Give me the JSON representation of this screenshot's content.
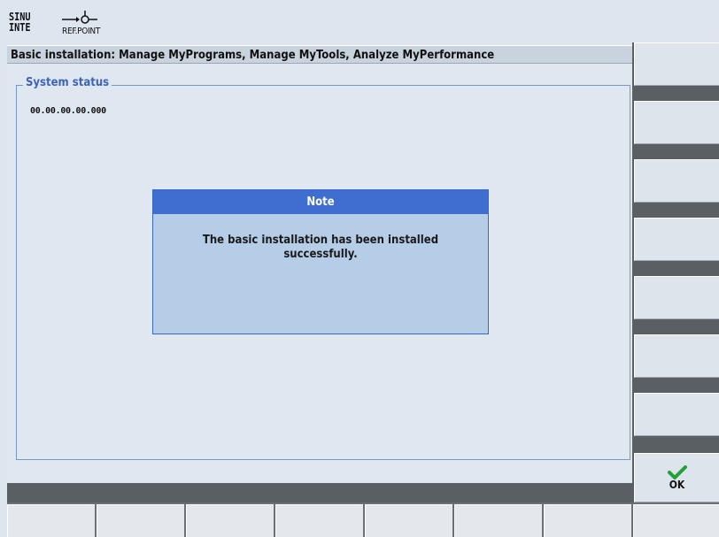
{
  "top": {
    "logo_line1": "SINU",
    "logo_line2": "INTE",
    "refpoint_label": "REF.POINT"
  },
  "header": {
    "title": "Basic installation: Manage MyPrograms, Manage MyTools, Analyze MyPerformance"
  },
  "main": {
    "group_title": "System status",
    "status_value": "00.00.00.00.000"
  },
  "dialog": {
    "title": "Note",
    "message": "The basic installation has been installed successfully."
  },
  "vertical_softkeys": {
    "ok_label": "OK",
    "ok_icon": "checkmark-icon",
    "ok_icon_color": "#22a03a"
  },
  "colors": {
    "dialog_title_bg": "#3e6fd0",
    "dialog_bg": "#b5cde6",
    "group_title": "#3e63b8"
  }
}
